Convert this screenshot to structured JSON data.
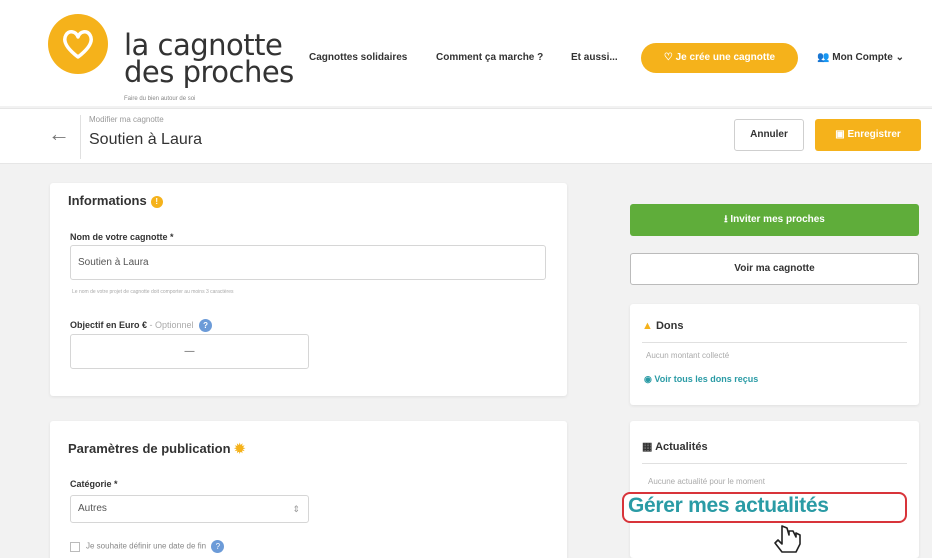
{
  "header": {
    "logo_line1": "la cagnotte",
    "logo_line2": "des proches",
    "logo_tagline": "Faire du bien autour de soi",
    "nav": [
      "Cagnottes solidaires",
      "Comment ça marche ?",
      "Et aussi..."
    ],
    "cta_label": "Je crée une cagnotte",
    "account_label": "Mon Compte"
  },
  "subheader": {
    "small_label": "Modifier ma cagnotte",
    "title": "Soutien à Laura",
    "cancel_label": "Annuler",
    "save_label": "Enregistrer"
  },
  "informations": {
    "title": "Informations",
    "name_label": "Nom de votre cagnotte *",
    "name_value": "Soutien à Laura",
    "name_hint": "Le nom de votre projet de cagnotte doit comporter au moins 3 caractères",
    "goal_label": "Objectif en Euro €",
    "goal_optional": "- Optionnel",
    "goal_value": "—"
  },
  "publication": {
    "title": "Paramètres de publication",
    "category_label": "Catégorie *",
    "category_value": "Autres",
    "end_date_label": "Je souhaite définir une date de fin"
  },
  "sidebar": {
    "invite_label": "Inviter mes proches",
    "view_label": "Voir ma cagnotte",
    "dons_title": "Dons",
    "dons_empty": "Aucun montant collecté",
    "dons_link": "Voir tous les dons reçus",
    "news_title": "Actualités",
    "news_empty": "Aucune actualité pour le moment",
    "news_link": "Gérer mes actualités"
  },
  "colors": {
    "brand_yellow": "#f5b21b",
    "invite_green": "#5fad3a",
    "link_teal": "#2a9ba5",
    "highlight_red": "#d8343a"
  }
}
